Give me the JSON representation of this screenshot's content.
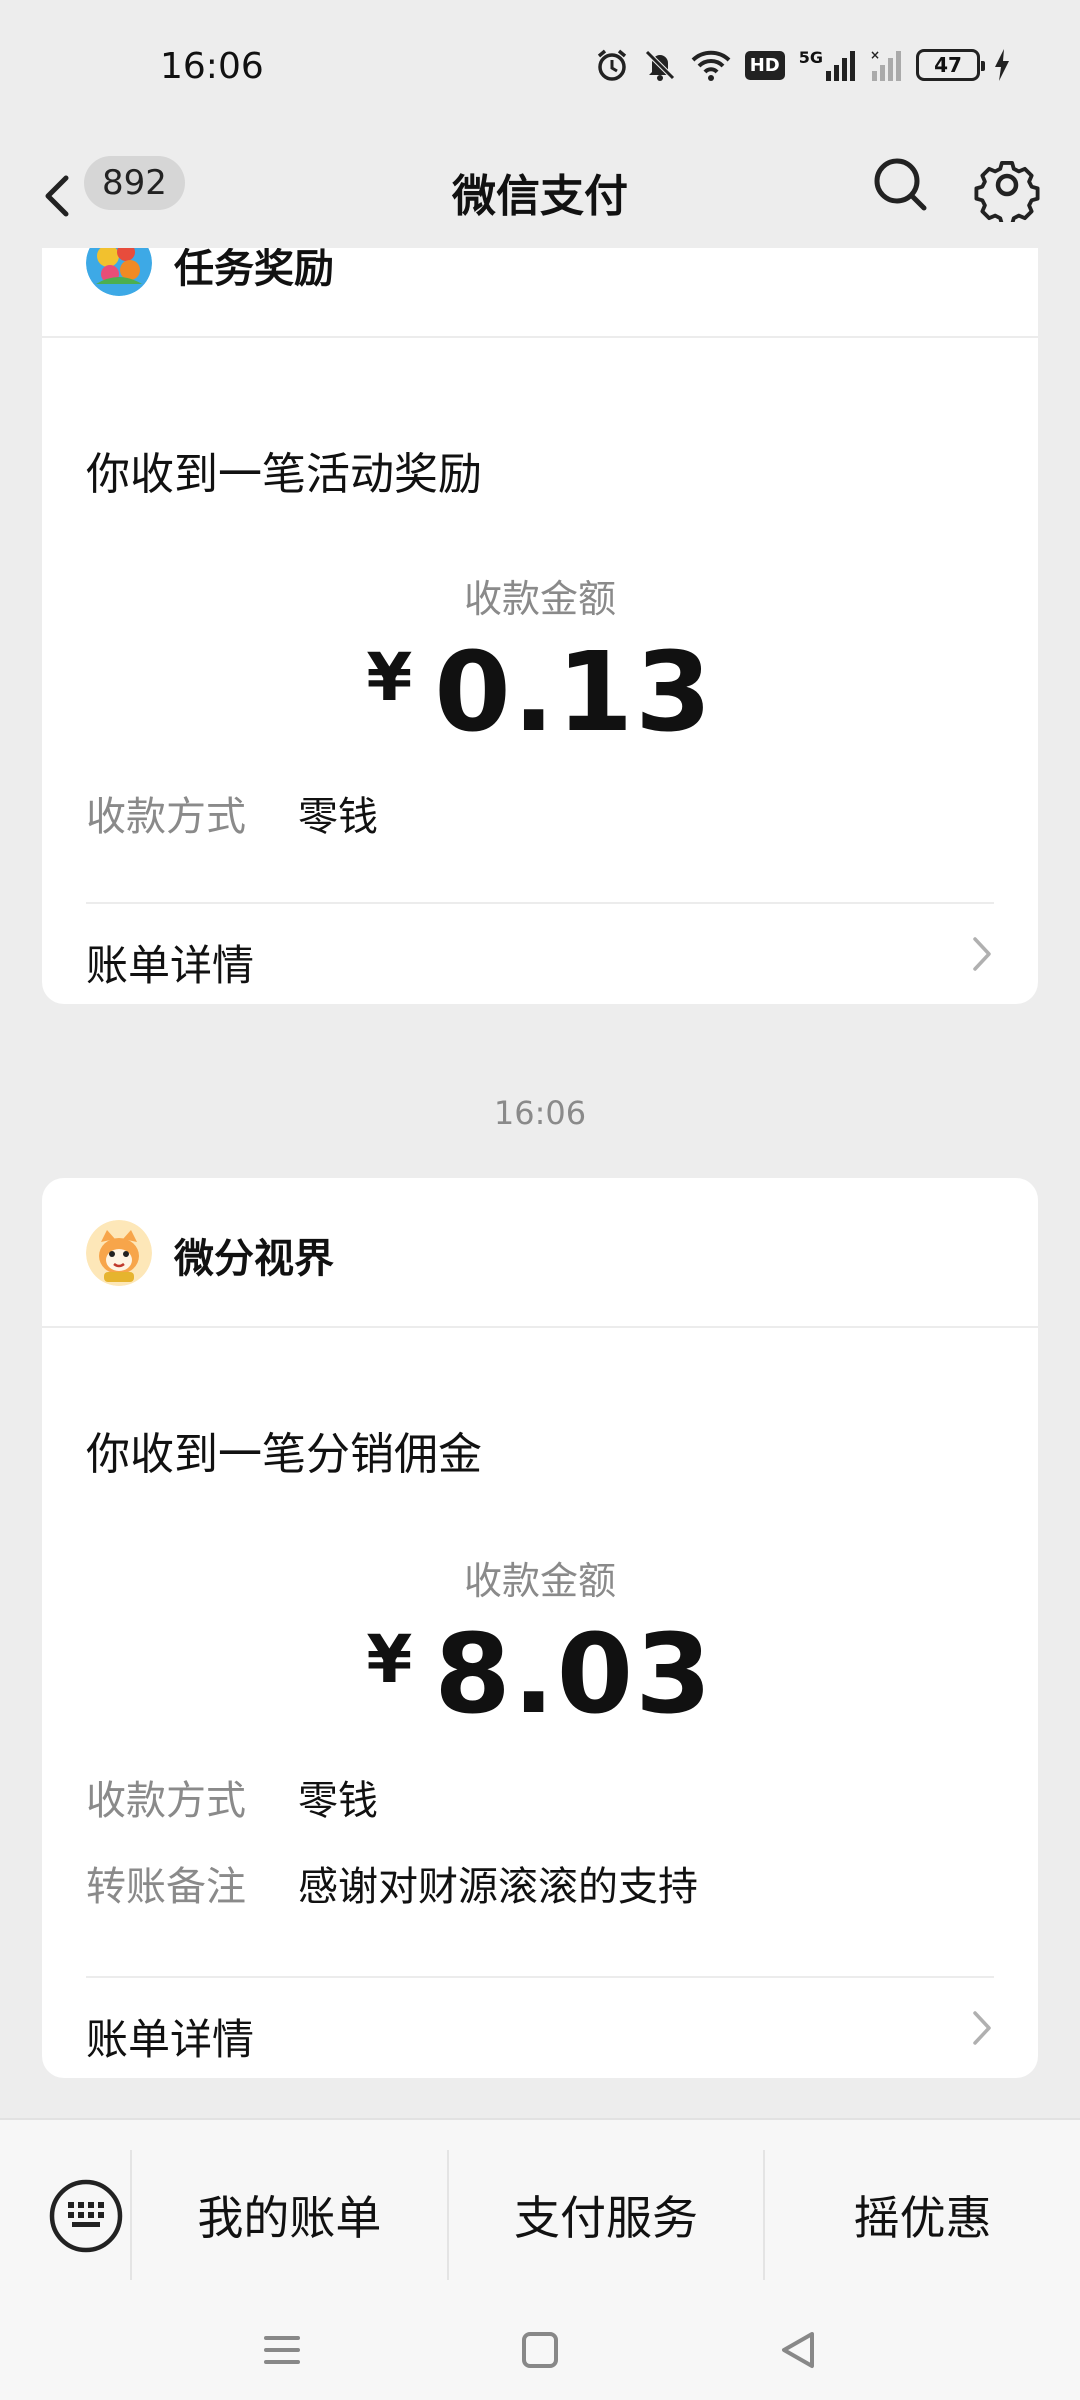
{
  "status": {
    "time": "16:06",
    "network": "5G",
    "hd": "HD",
    "battery": "47"
  },
  "nav": {
    "unread_count": "892",
    "title": "微信支付"
  },
  "cards": [
    {
      "sender": "任务奖励",
      "title": "你收到一笔活动奖励",
      "amount_label": "收款金额",
      "currency": "¥",
      "amount": "0.13",
      "details": [
        {
          "key": "收款方式",
          "value": "零钱"
        }
      ],
      "bill_link": "账单详情"
    },
    {
      "timestamp": "16:06",
      "sender": "微分视界",
      "title": "你收到一笔分销佣金",
      "amount_label": "收款金额",
      "currency": "¥",
      "amount": "8.03",
      "details": [
        {
          "key": "收款方式",
          "value": "零钱"
        },
        {
          "key": "转账备注",
          "value": "感谢对财源滚滚的支持"
        }
      ],
      "bill_link": "账单详情"
    }
  ],
  "bottom_menu": {
    "items": [
      "我的账单",
      "支付服务",
      "摇优惠"
    ]
  },
  "colors": {
    "background": "#ededed",
    "card": "#ffffff",
    "muted_text": "#8a8a8a",
    "primary_text": "#111111"
  }
}
